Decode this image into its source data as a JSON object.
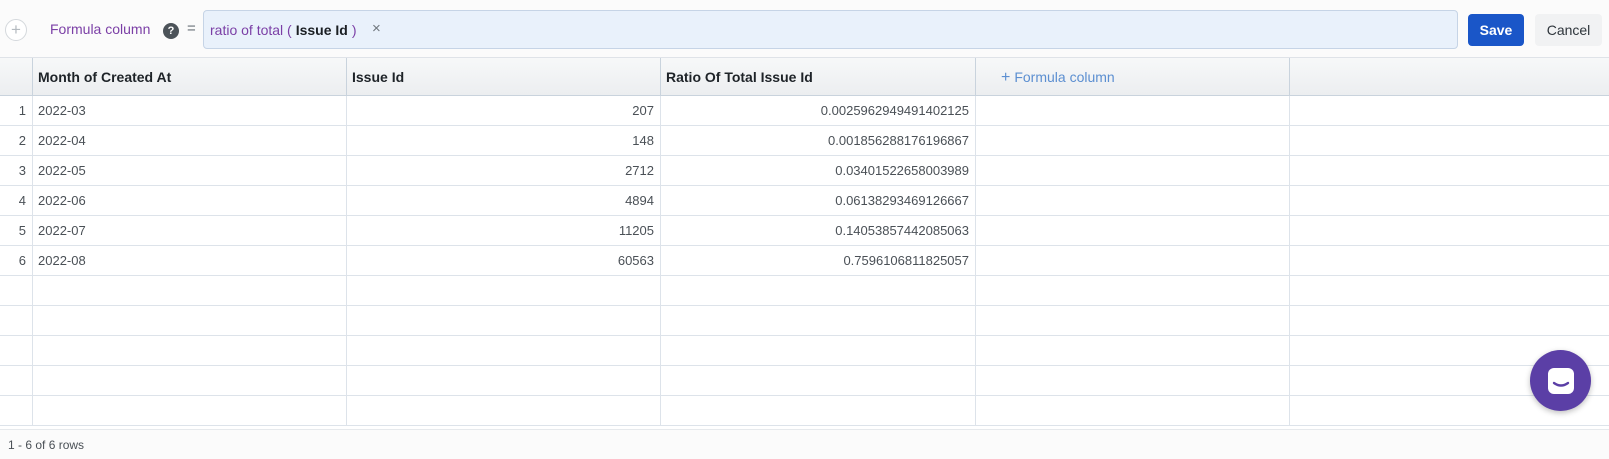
{
  "formula_bar": {
    "label": "Formula column",
    "help_glyph": "?",
    "equals": "=",
    "formula": {
      "function": "ratio of total",
      "open_paren": "(",
      "argument": "Issue Id",
      "close_paren": ")"
    },
    "clear_glyph": "×",
    "save_label": "Save",
    "cancel_label": "Cancel"
  },
  "table": {
    "columns": [
      "Month of Created At",
      "Issue Id",
      "Ratio Of Total Issue Id"
    ],
    "add_column_label": "Formula column",
    "rows": [
      {
        "index": "1",
        "month": "2022-03",
        "issue_id": "207",
        "ratio": "0.0025962949491402125"
      },
      {
        "index": "2",
        "month": "2022-04",
        "issue_id": "148",
        "ratio": "0.001856288176196867"
      },
      {
        "index": "3",
        "month": "2022-05",
        "issue_id": "2712",
        "ratio": "0.03401522658003989"
      },
      {
        "index": "4",
        "month": "2022-06",
        "issue_id": "4894",
        "ratio": "0.06138293469126667"
      },
      {
        "index": "5",
        "month": "2022-07",
        "issue_id": "11205",
        "ratio": "0.14053857442085063"
      },
      {
        "index": "6",
        "month": "2022-08",
        "issue_id": "60563",
        "ratio": "0.7596106811825057"
      }
    ]
  },
  "footer": {
    "row_count": "1 - 6 of 6 rows"
  },
  "icons": {
    "add": "plus-icon",
    "help": "question-icon",
    "clear": "close-icon",
    "chat": "chat-icon"
  },
  "colors": {
    "accent": "#1a56c8",
    "formula_purple": "#7b3fa6",
    "chat_launcher": "#5b3fa6"
  }
}
